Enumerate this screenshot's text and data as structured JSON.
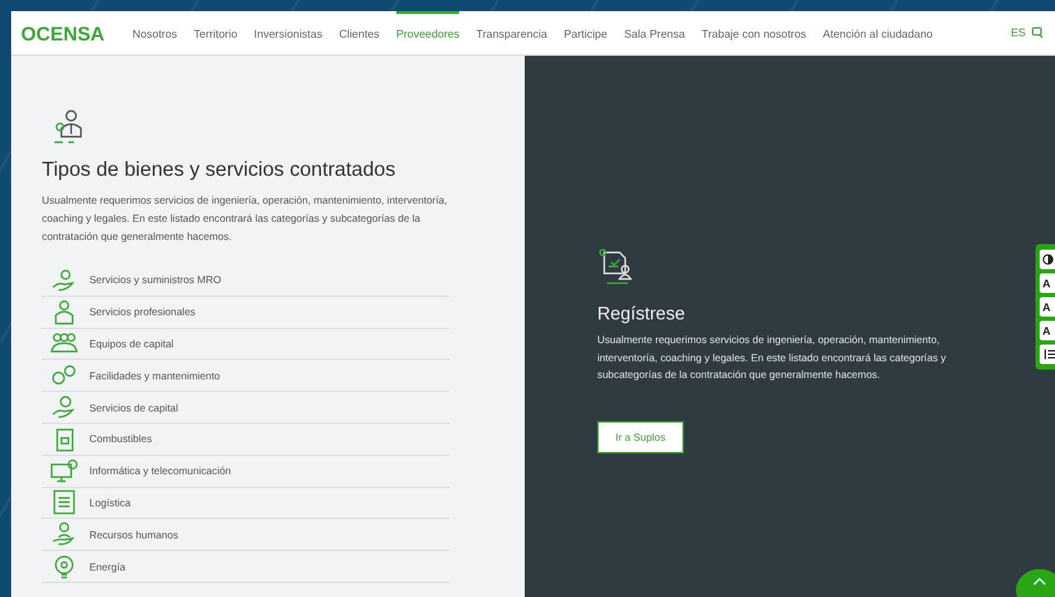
{
  "nav": {
    "logo": "OCENSA",
    "items": [
      {
        "label": "Nosotros",
        "selected": false
      },
      {
        "label": "Territorio",
        "selected": false
      },
      {
        "label": "Inversionistas",
        "selected": false
      },
      {
        "label": "Clientes",
        "selected": false
      },
      {
        "label": "Proveedores",
        "selected": true
      },
      {
        "label": "Transparencia",
        "selected": false
      },
      {
        "label": "Participe",
        "selected": false
      },
      {
        "label": "Sala Prensa",
        "selected": false
      },
      {
        "label": "Trabaje con nosotros",
        "selected": false
      },
      {
        "label": "Atención al ciudadano",
        "selected": false
      }
    ],
    "language": "ES"
  },
  "categories": {
    "title": "Tipos de bienes y servicios contratados",
    "text": "Usualmente requerimos servicios de ingeniería, operación, mantenimiento, interventoría, coaching y legales. En este listado encontrará las categorías y subcategorías de la contratación que generalmente hacemos.",
    "items": [
      "Servicios y suministros MRO",
      "Servicios profesionales",
      "Equipos de capital",
      "Facilidades y mantenimiento",
      "Servicios de capital",
      "Combustibles",
      "Informática y telecomunicación",
      "Logística",
      "Recursos humanos",
      "Energía"
    ]
  },
  "register": {
    "title": "Regístrese",
    "text": "Usualmente requerimos servicios de ingeniería, operación, mantenimiento, interventoría, coaching y legales. En este listado encontrará las categorías y subcategorías de la contratación que generalmente hacemos.",
    "button": "Ir a Suplos"
  },
  "accessibility": [
    {
      "kind": "contrast"
    },
    {
      "kind": "text",
      "label": "A"
    },
    {
      "kind": "text",
      "label": "A"
    },
    {
      "kind": "text",
      "label": "A"
    },
    {
      "kind": "spacing"
    }
  ]
}
